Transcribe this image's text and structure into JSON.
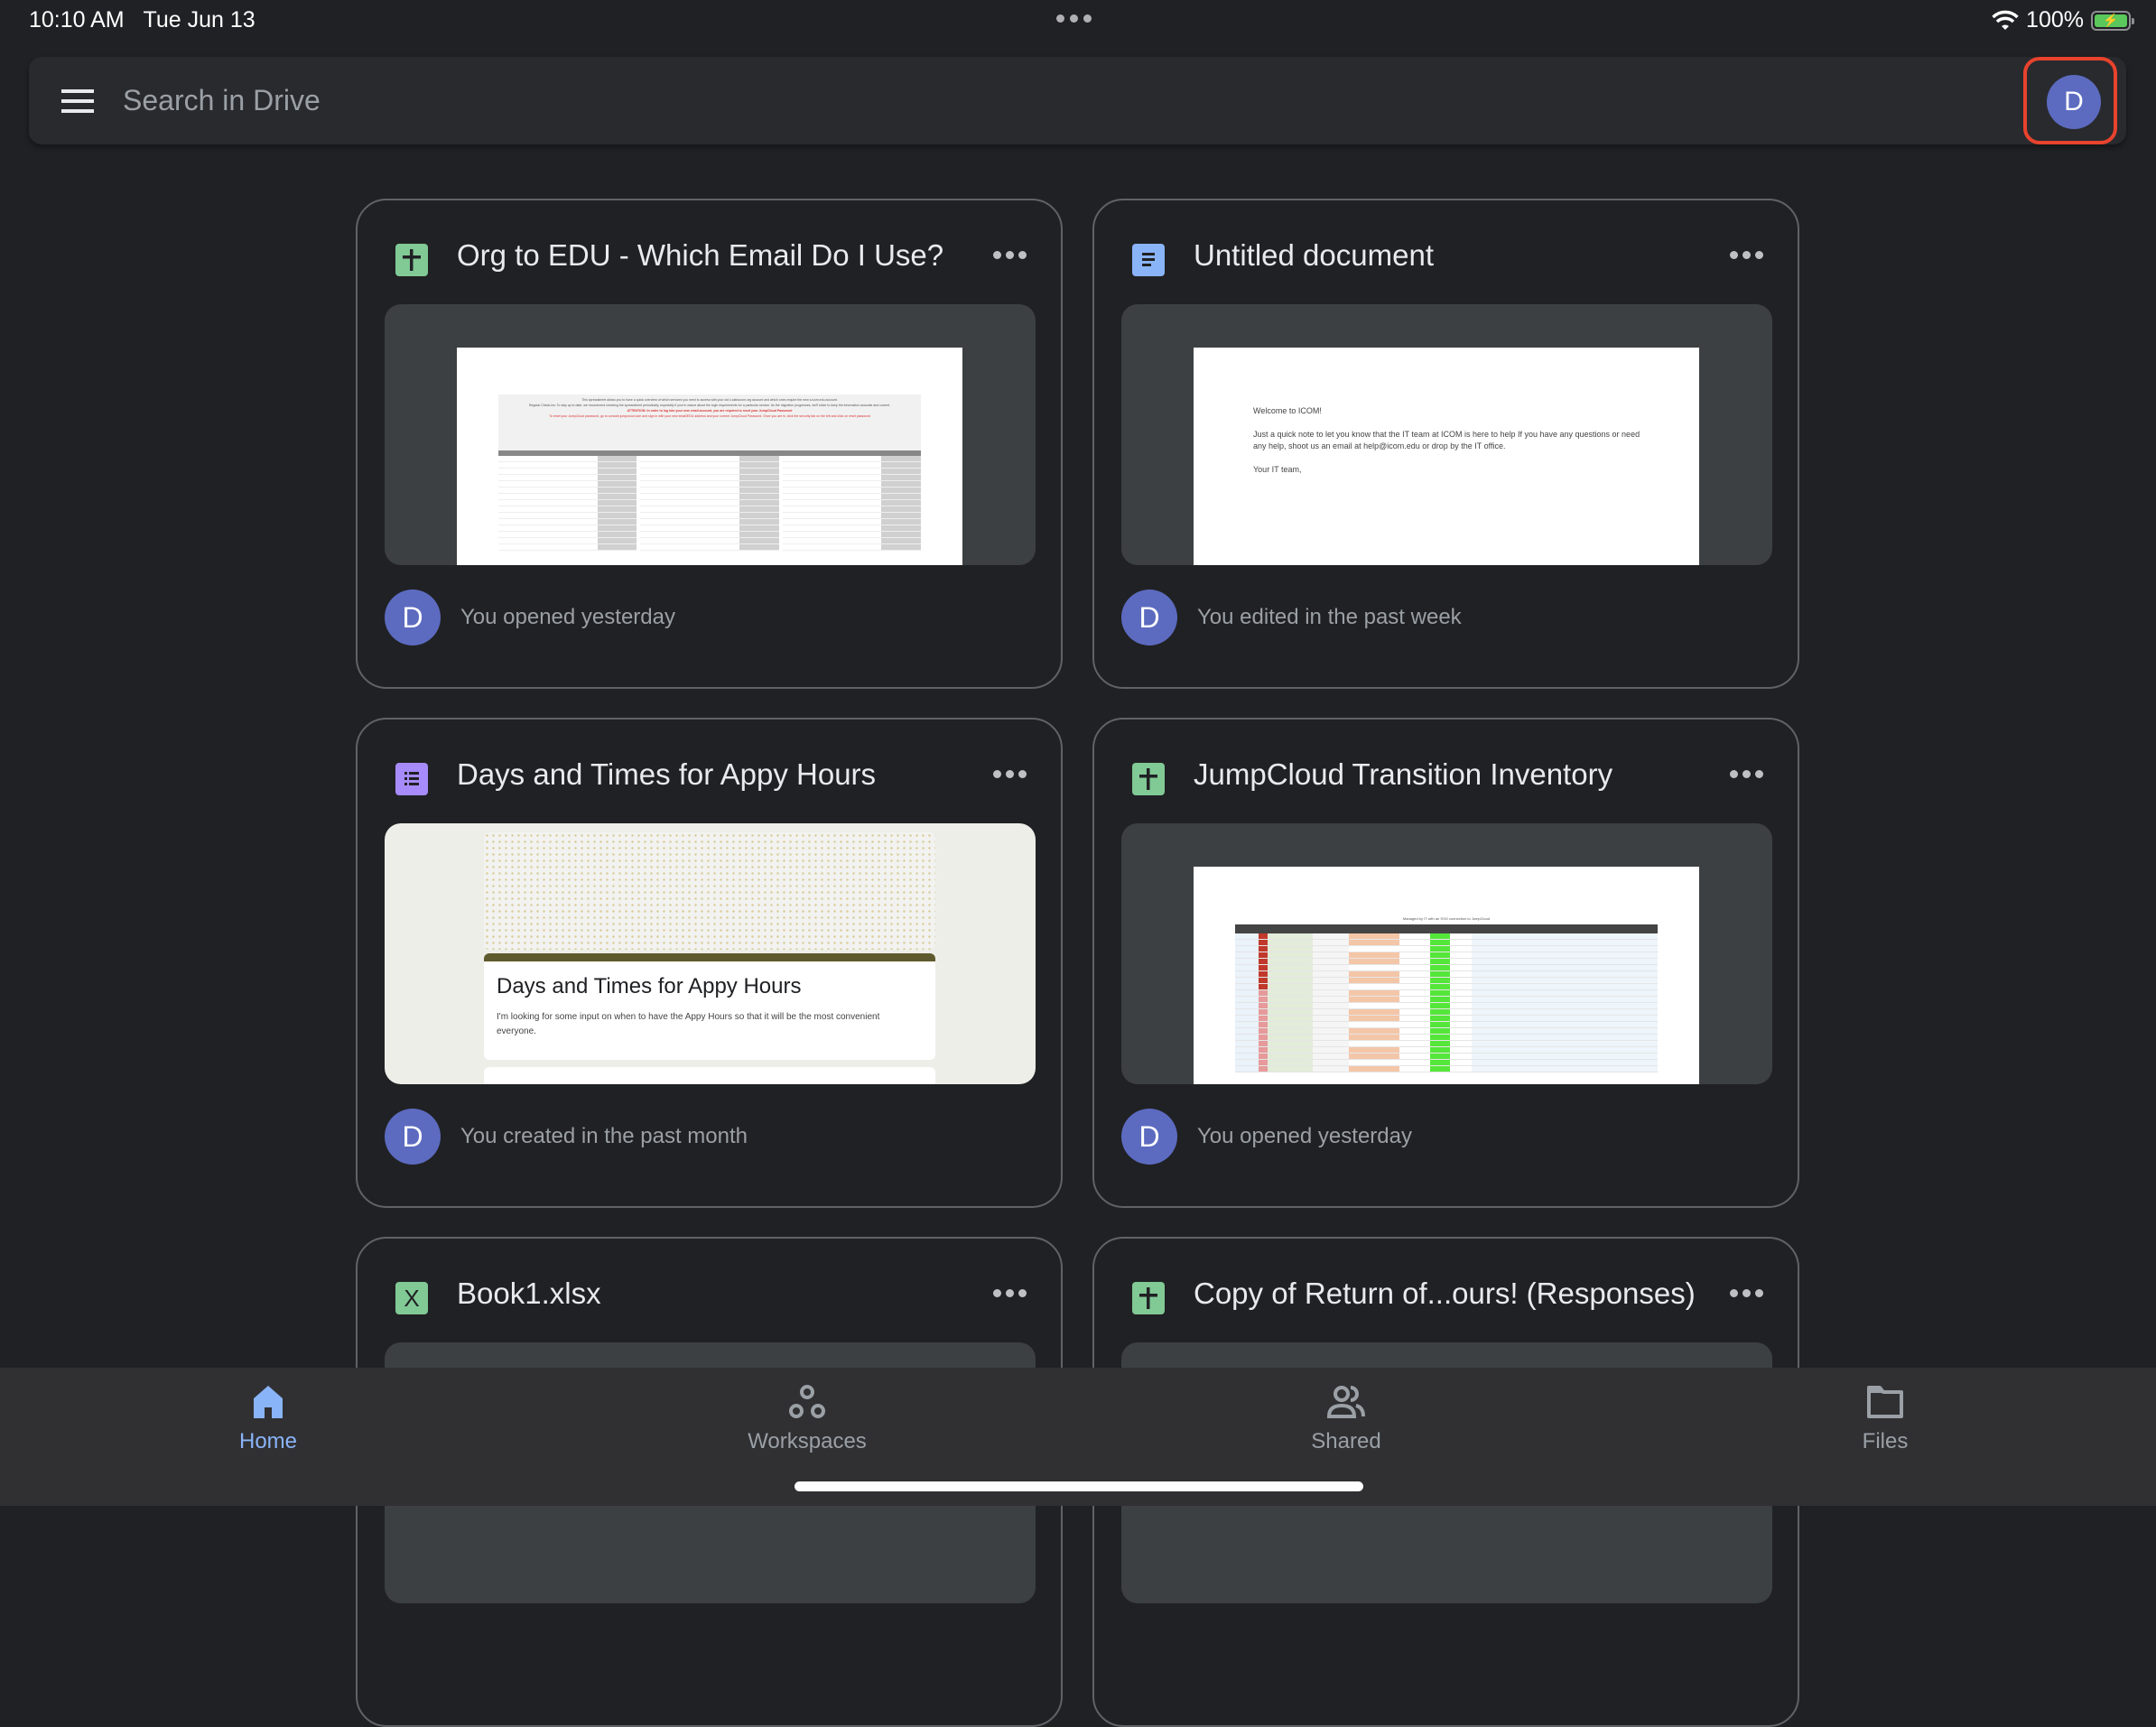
{
  "status_bar": {
    "time": "10:10 AM",
    "date": "Tue Jun 13",
    "battery": "100%",
    "icons": [
      "wifi-icon",
      "battery-charging-icon"
    ]
  },
  "search": {
    "placeholder": "Search in Drive",
    "value": "",
    "account_initial": "D"
  },
  "colors": {
    "accent": "#8ab4f8",
    "avatar": "#5c6bc0",
    "highlight": "#e8432d",
    "sheets_icon": "#81c995",
    "docs_icon": "#8ab4f8",
    "forms_icon": "#a78bfa"
  },
  "files": [
    {
      "title": "Org to EDU - Which Email Do I Use?",
      "type": "sheets-icon",
      "activity": "You opened yesterday",
      "owner_initial": "D",
      "preview": {
        "intro": "This spreadsheet allows you to have a quick overview of which services you need to access with your old s.idahocom.org account and which ones require the new s.icom.edu account.",
        "check_ins": "Regular Check-ins: To stay up to date, we recommend checking the spreadsheet periodically, especially if you're unsure about the login requirements for a particular service. As the migration progresses, we'll strive to keep the information accurate and current.",
        "attention": "ATTENTION: In order to log into your new email account, you are required to reset your JumpCloud Password",
        "reset": "To reset your JumpCloud password, go to console.jumpcloud.com and sign in with your new email/EDU address and your current JumpCloud Password. Once you are in, click the security tab on the left and click on reset password"
      }
    },
    {
      "title": "Untitled document",
      "type": "docs-icon",
      "activity": "You edited in the past week",
      "owner_initial": "D",
      "preview": {
        "lines": [
          "Welcome to ICOM!",
          "Just a quick note to let you know that the IT team at ICOM is here to help If you have any questions or need any help, shoot us an email at help@icom.edu or drop by the IT office.",
          "Your IT team,"
        ]
      }
    },
    {
      "title": "Days and Times for Appy Hours",
      "type": "forms-icon",
      "activity": "You created in the past month",
      "owner_initial": "D",
      "preview": {
        "form_title": "Days and Times for Appy Hours",
        "form_description": "I'm looking for some input on when to have the Appy Hours so that it will be the most convenient everyone."
      }
    },
    {
      "title": "JumpCloud Transition Inventory",
      "type": "sheets-icon",
      "activity": "You opened yesterday",
      "owner_initial": "D",
      "preview": {
        "sheet_title": "Managed by IT with an SSO connection to JumpCloud"
      }
    },
    {
      "title": "Book1.xlsx",
      "type": "excel-icon",
      "activity": "",
      "owner_initial": ""
    },
    {
      "title": "Copy of Return of...ours! (Responses)",
      "type": "sheets-icon",
      "activity": "",
      "owner_initial": ""
    }
  ],
  "nav": {
    "items": [
      {
        "label": "Home",
        "icon": "home-icon",
        "active": true
      },
      {
        "label": "Workspaces",
        "icon": "workspaces-icon",
        "active": false
      },
      {
        "label": "Shared",
        "icon": "shared-icon",
        "active": false
      },
      {
        "label": "Files",
        "icon": "folder-icon",
        "active": false
      }
    ]
  }
}
